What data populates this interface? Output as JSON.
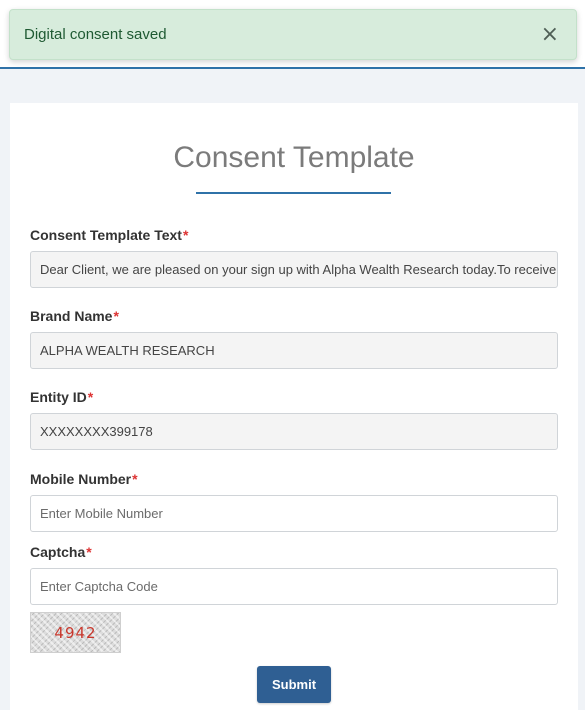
{
  "toast": {
    "message": "Digital consent saved",
    "close_glyph": "×"
  },
  "form": {
    "title": "Consent Template",
    "required_marker": "*",
    "template_text": {
      "label": "Consent Template Text",
      "value": "Dear Client, we are pleased on your sign up with Alpha Wealth Research today.To receive e"
    },
    "brand_name": {
      "label": "Brand Name",
      "value": "ALPHA WEALTH RESEARCH"
    },
    "entity_id": {
      "label": "Entity ID",
      "value": "XXXXXXXX399178"
    },
    "mobile": {
      "label": "Mobile Number",
      "placeholder": "Enter Mobile Number"
    },
    "captcha": {
      "label": "Captcha",
      "placeholder": "Enter Captcha Code",
      "code": "4942"
    },
    "submit_label": "Submit"
  },
  "colors": {
    "accent": "#2f72a8",
    "button": "#2f5f93",
    "toast_bg": "#d7ecdc",
    "required": "#dd3333"
  }
}
